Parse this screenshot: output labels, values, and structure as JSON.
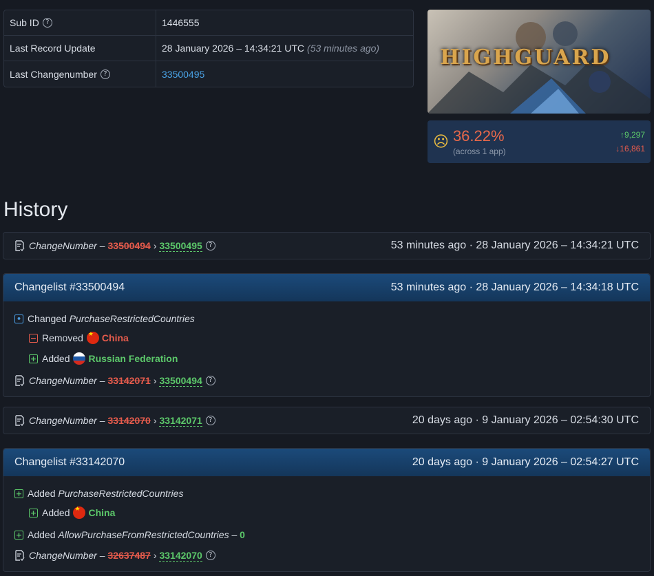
{
  "info": {
    "sub_id_label": "Sub ID",
    "sub_id_value": "1446555",
    "last_update_label": "Last Record Update",
    "last_update_value": "28 January 2026 – 14:34:21 UTC",
    "last_update_ago": "(53 minutes ago)",
    "last_change_label": "Last Changenumber",
    "last_change_value": "33500495"
  },
  "banner": {
    "title": "HIGHGUARD"
  },
  "rating": {
    "percent": "36.22%",
    "sub": "(across 1 app)",
    "up": "9,297",
    "down": "16,861",
    "up_icon": "arrow-up-icon",
    "down_icon": "arrow-down-icon",
    "face_icon": "sad-face-icon"
  },
  "history_title": "History",
  "entries": [
    {
      "label": "ChangeNumber –",
      "old": "33500494",
      "new": "33500495",
      "time": "53 minutes ago · 28 January 2026 – 14:34:21 UTC"
    },
    {
      "title": "Changelist #33500494",
      "time": "53 minutes ago · 28 January 2026 – 14:34:18 UTC",
      "changed_prefix": "Changed",
      "changed_key": "PurchaseRestrictedCountries",
      "removed_label": "Removed",
      "removed_country": "China",
      "added_label": "Added",
      "added_country": "Russian Federation",
      "cn_label": "ChangeNumber –",
      "cn_old": "33142071",
      "cn_new": "33500494"
    },
    {
      "label": "ChangeNumber –",
      "old": "33142070",
      "new": "33142071",
      "time": "20 days ago · 9 January 2026 – 02:54:30 UTC"
    },
    {
      "title": "Changelist #33142070",
      "time": "20 days ago · 9 January 2026 – 02:54:27 UTC",
      "added_prefix": "Added",
      "added_key": "PurchaseRestrictedCountries",
      "sub_added_label": "Added",
      "sub_added_country": "China",
      "added2_prefix": "Added",
      "added2_key": "AllowPurchaseFromRestrictedCountries",
      "added2_sep": " – ",
      "added2_value": "0",
      "cn_label": "ChangeNumber –",
      "cn_old": "32637487",
      "cn_new": "33142070"
    }
  ],
  "arrow": "›",
  "qmark": "?",
  "colors": {
    "accent_blue": "#4aa3e6",
    "green": "#5cc86a",
    "red": "#e55b4c",
    "rating_bg": "#1f3350"
  }
}
